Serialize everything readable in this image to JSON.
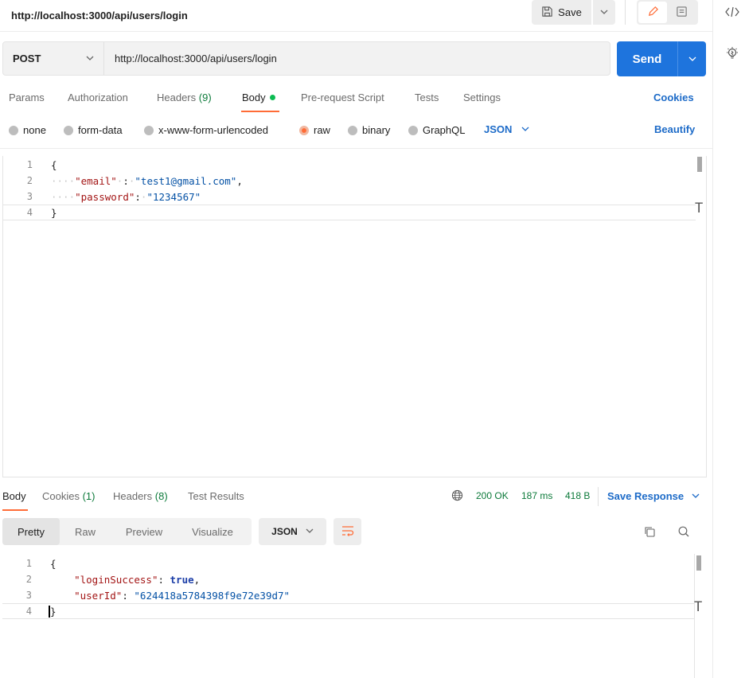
{
  "request_title": "http://localhost:3000/api/users/login",
  "header_actions": {
    "save_label": "Save"
  },
  "request": {
    "method": "POST",
    "url": "http://localhost:3000/api/users/login",
    "send_label": "Send"
  },
  "request_tabs": {
    "params": "Params",
    "authorization": "Authorization",
    "headers": "Headers",
    "headers_count": "(9)",
    "body": "Body",
    "pre_request": "Pre-request Script",
    "tests": "Tests",
    "settings": "Settings",
    "cookies": "Cookies"
  },
  "body_types": {
    "none": "none",
    "form_data": "form-data",
    "urlencoded": "x-www-form-urlencoded",
    "raw": "raw",
    "binary": "binary",
    "graphql": "GraphQL",
    "format": "JSON",
    "beautify": "Beautify",
    "selected": "raw"
  },
  "request_body": {
    "line_numbers": [
      "1",
      "2",
      "3",
      "4"
    ],
    "open_brace": "{",
    "close_brace": "}",
    "email_key": "\"email\"",
    "email_colon": ":",
    "email_value": "\"test1@gmail.com\"",
    "password_key": "\"password\"",
    "password_colon": ":",
    "password_value": "\"1234567\""
  },
  "response_tabs": {
    "body": "Body",
    "cookies": "Cookies",
    "cookies_count": "(1)",
    "headers": "Headers",
    "headers_count": "(8)",
    "test_results": "Test Results"
  },
  "response_meta": {
    "status": "200 OK",
    "time": "187 ms",
    "size": "418 B",
    "save_response": "Save Response"
  },
  "response_view": {
    "pretty": "Pretty",
    "raw": "Raw",
    "preview": "Preview",
    "visualize": "Visualize",
    "format": "JSON"
  },
  "response_body": {
    "line_numbers": [
      "1",
      "2",
      "3",
      "4"
    ],
    "open_brace": "{",
    "close_brace": "}",
    "login_key": "\"loginSuccess\"",
    "login_value": "true",
    "userid_key": "\"userId\"",
    "userid_value": "\"624418a5784398f9e72e39d7\""
  },
  "colors": {
    "send_button": "#1e74dd",
    "active_tab_underline": "#ff6c37",
    "status_green": "#0c7a3a",
    "link_blue": "#1d6bc8"
  },
  "icons": [
    "save-icon",
    "chevron-down-icon",
    "pencil-icon",
    "doc-comment-icon",
    "code-icon",
    "lightbulb-icon",
    "globe-icon",
    "copy-icon",
    "search-icon",
    "wrap-lines-icon"
  ]
}
